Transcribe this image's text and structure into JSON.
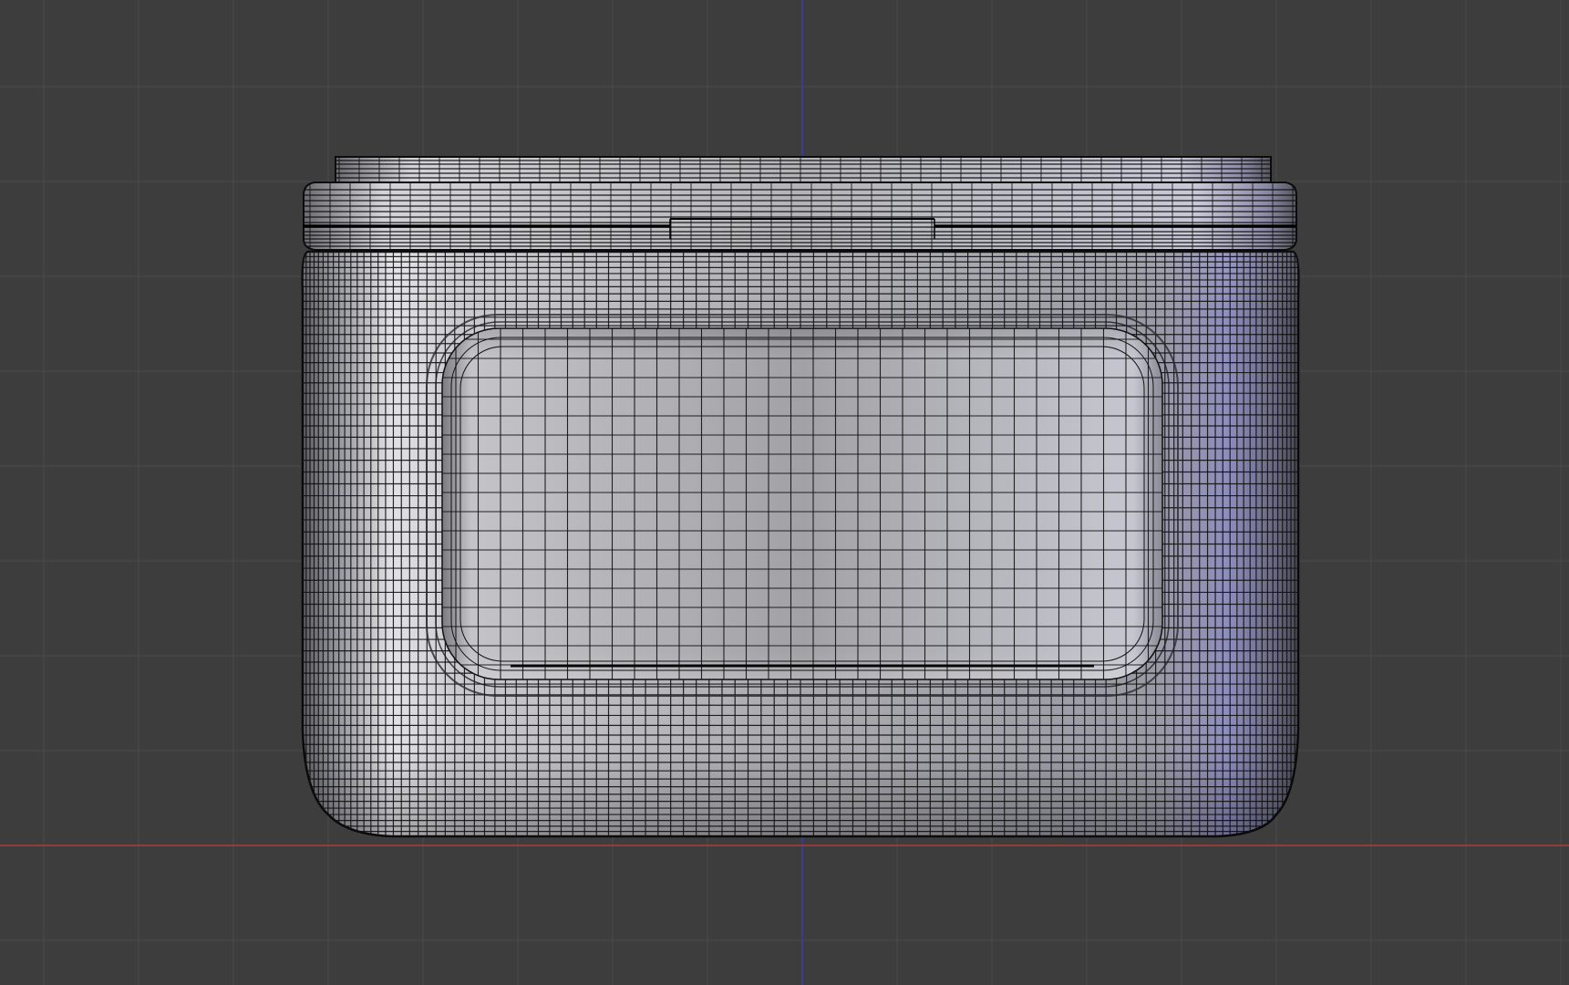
{
  "viewport": {
    "view": "front-orthographic",
    "shading": "solid-with-wireframe",
    "background_color": "#3d3d3d",
    "grid_line_color": "#4a4a4a",
    "x_axis_color": "#b03a3a",
    "z_axis_color": "#3a3ab0",
    "grid_visible": true
  },
  "mesh": {
    "object": "jar-with-lid",
    "wire_color": "#111111",
    "surface_light": "#e6e6ea",
    "surface_mid": "#a7a7ad",
    "surface_dark": "#6d6d78",
    "edge_tint": "#8c8ccc",
    "parts": [
      "lid-top-rim",
      "lid-band",
      "jar-body",
      "front-recessed-panel"
    ]
  }
}
